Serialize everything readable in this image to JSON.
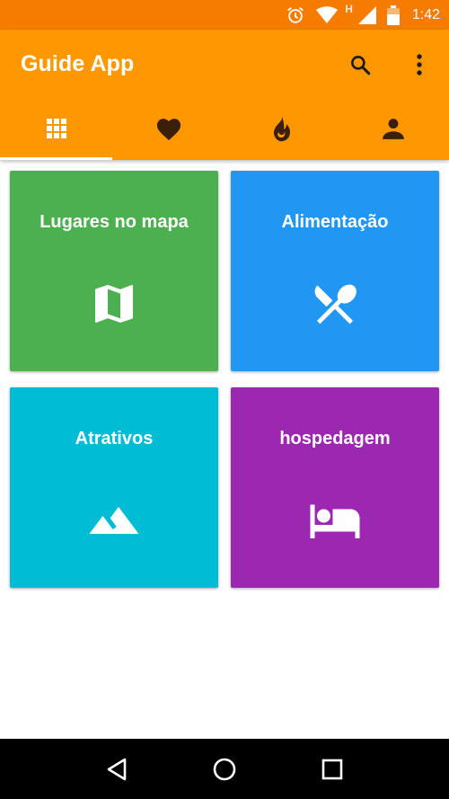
{
  "status_bar": {
    "time": "1:42",
    "network_letter": "H",
    "icons": [
      "alarm-icon",
      "wifi-icon",
      "signal-icon",
      "battery-icon"
    ]
  },
  "app_bar": {
    "title": "Guide App",
    "actions": [
      "search-icon",
      "more-vert-icon"
    ],
    "background": "#ff9800",
    "status_background": "#f57c00"
  },
  "tabs": [
    {
      "icon": "grid-icon",
      "selected": true
    },
    {
      "icon": "heart-icon",
      "selected": false
    },
    {
      "icon": "fire-icon",
      "selected": false
    },
    {
      "icon": "person-icon",
      "selected": false
    }
  ],
  "cards": [
    {
      "label": "Lugares no mapa",
      "icon": "map-icon",
      "color": "#4caf50"
    },
    {
      "label": "Alimentação",
      "icon": "restaurant-icon",
      "color": "#2196f3"
    },
    {
      "label": "Atrativos",
      "icon": "terrain-icon",
      "color": "#00bcd4"
    },
    {
      "label": "hospedagem",
      "icon": "hotel-icon",
      "color": "#9c27b0"
    }
  ],
  "nav_bar": {
    "buttons": [
      "back-icon",
      "home-icon",
      "recents-icon"
    ]
  }
}
